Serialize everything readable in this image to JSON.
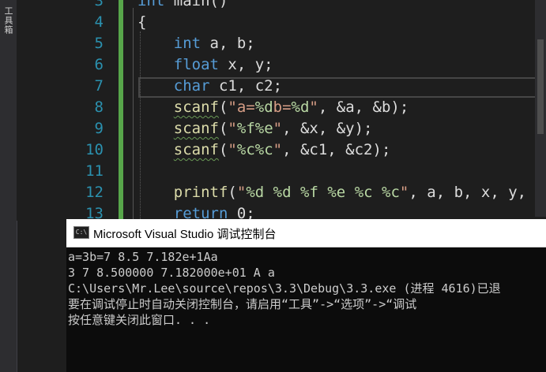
{
  "sidebar": {
    "label": "工具箱"
  },
  "editor": {
    "line_numbers": [
      "3",
      "4",
      "5",
      "6",
      "7",
      "8",
      "9",
      "10",
      "11",
      "12",
      "13"
    ],
    "lines": {
      "l3": {
        "kw": "int",
        "rest": " main()"
      },
      "l4": {
        "text": "{"
      },
      "l5": {
        "kw": "int",
        "rest": " a, b;"
      },
      "l6": {
        "kw": "float",
        "rest": " x, y;"
      },
      "l7": {
        "kw": "char",
        "rest": " c1, c2;"
      },
      "l8": {
        "fn": "scanf",
        "open": "(",
        "s1": "\"a=",
        "f1": "%d",
        "s2": "b=",
        "f2": "%d",
        "s3": "\"",
        "rest": ", &a, &b);"
      },
      "l9": {
        "fn": "scanf",
        "open": "(",
        "s1": "\"",
        "f1": "%f",
        "f2": "%e",
        "s3": "\"",
        "rest": ", &x, &y);"
      },
      "l10": {
        "fn": "scanf",
        "open": "(",
        "s1": "\"",
        "f1": "%c",
        "f2": "%c",
        "s3": "\"",
        "rest": ", &c1, &c2);"
      },
      "l12": {
        "fn": "printf",
        "open": "(",
        "s1": "\"",
        "f1": "%d",
        "f2": "%d",
        "f3": "%f",
        "f4": "%e",
        "f5": "%c",
        "f6": "%c",
        "s3": "\"",
        "rest": ", a, b, x, y, c"
      },
      "l13": {
        "kw": "return",
        "rest": " 0;"
      }
    }
  },
  "console": {
    "title": "Microsoft Visual Studio 调试控制台",
    "icon": "C:\\",
    "output": [
      "a=3b=7 8.5 7.182e+1Aa",
      "3 7 8.500000 7.182000e+01 A a",
      "C:\\Users\\Mr.Lee\\source\\repos\\3.3\\Debug\\3.3.exe (进程 4616)已退",
      "要在调试停止时自动关闭控制台，请启用“工具”->“选项”->“调试",
      "按任意键关闭此窗口. . ."
    ]
  },
  "colors": {
    "keyword": "#569cd6",
    "string": "#d69d85",
    "format": "#b8d7a3",
    "function": "#dcdcaa",
    "line_number": "#2b91af",
    "change_bar": "#57a64a"
  }
}
